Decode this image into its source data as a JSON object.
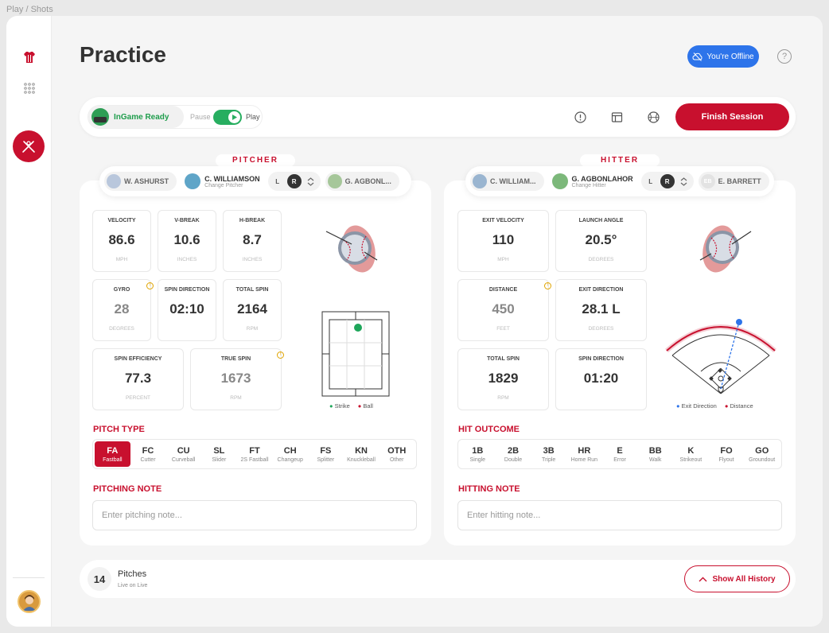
{
  "breadcrumb": "Play / Shots",
  "page_title": "Practice",
  "header": {
    "offline_label": "You're Offline",
    "help_symbol": "?"
  },
  "topbar": {
    "device_label": "InGame Ready",
    "pause_label": "Pause",
    "play_label": "Play",
    "finish_label": "Finish Session"
  },
  "pitcher": {
    "section_label": "PITCHER",
    "prev_name": "W. ASHURST",
    "current_name": "C. WILLIAMSON",
    "change_label": "Change Pitcher",
    "hand_l": "L",
    "hand_r": "R",
    "next_name": "G. AGBONL...",
    "stats": [
      {
        "label": "VELOCITY",
        "value": "86.6",
        "unit": "MPH"
      },
      {
        "label": "V-BREAK",
        "value": "10.6",
        "unit": "INCHES"
      },
      {
        "label": "H-BREAK",
        "value": "8.7",
        "unit": "INCHES"
      },
      {
        "label": "GYRO",
        "value": "28",
        "unit": "DEGREES"
      },
      {
        "label": "SPIN DIRECTION",
        "value": "02:10",
        "unit": ""
      },
      {
        "label": "TOTAL SPIN",
        "value": "2164",
        "unit": "RPM"
      },
      {
        "label": "SPIN EFFICIENCY",
        "value": "77.3",
        "unit": "PERCENT"
      },
      {
        "label": "TRUE SPIN",
        "value": "1673",
        "unit": "RPM"
      }
    ],
    "legend_strike": "Strike",
    "legend_ball": "Ball",
    "pitch_type_heading": "PITCH TYPE",
    "pitch_types": [
      {
        "code": "FA",
        "name": "Fastball"
      },
      {
        "code": "FC",
        "name": "Cutter"
      },
      {
        "code": "CU",
        "name": "Curveball"
      },
      {
        "code": "SL",
        "name": "Slider"
      },
      {
        "code": "FT",
        "name": "2S Fastball"
      },
      {
        "code": "CH",
        "name": "Changeup"
      },
      {
        "code": "FS",
        "name": "Splitter"
      },
      {
        "code": "KN",
        "name": "Knuckleball"
      },
      {
        "code": "OTH",
        "name": "Other"
      }
    ],
    "selected_pitch": "FA",
    "note_heading": "PITCHING NOTE",
    "note_placeholder": "Enter pitching note..."
  },
  "hitter": {
    "section_label": "HITTER",
    "prev_name": "C. WILLIAM...",
    "current_name": "G. AGBONLAHOR",
    "change_label": "Change Hitter",
    "hand_l": "L",
    "hand_r": "R",
    "next_initials": "EB",
    "next_name": "E. BARRETT",
    "stats": [
      {
        "label": "EXIT VELOCITY",
        "value": "110",
        "unit": "MPH"
      },
      {
        "label": "LAUNCH ANGLE",
        "value": "20.5°",
        "unit": "DEGREES"
      },
      {
        "label": "DISTANCE",
        "value": "450",
        "unit": "FEET"
      },
      {
        "label": "EXIT DIRECTION",
        "value": "28.1 L",
        "unit": "DEGREES"
      },
      {
        "label": "TOTAL SPIN",
        "value": "1829",
        "unit": "RPM"
      },
      {
        "label": "SPIN DIRECTION",
        "value": "01:20",
        "unit": ""
      }
    ],
    "legend_exit": "Exit Direction",
    "legend_distance": "Distance",
    "outcome_heading": "HIT OUTCOME",
    "outcomes": [
      {
        "code": "1B",
        "name": "Single"
      },
      {
        "code": "2B",
        "name": "Double"
      },
      {
        "code": "3B",
        "name": "Triple"
      },
      {
        "code": "HR",
        "name": "Home Run"
      },
      {
        "code": "E",
        "name": "Error"
      },
      {
        "code": "BB",
        "name": "Walk"
      },
      {
        "code": "K",
        "name": "Strikeout"
      },
      {
        "code": "FO",
        "name": "Flyout"
      },
      {
        "code": "GO",
        "name": "Groundout"
      }
    ],
    "note_heading": "HITTING NOTE",
    "note_placeholder": "Enter hitting note..."
  },
  "footer": {
    "count": "14",
    "label": "Pitches",
    "sublabel": "Live on Live",
    "history_label": "Show All History"
  },
  "colors": {
    "accent": "#c8102e",
    "offline": "#2d74ea",
    "ready": "#27ae60"
  }
}
